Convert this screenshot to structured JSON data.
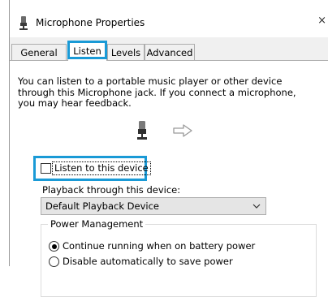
{
  "window": {
    "title": "Microphone Properties",
    "close_glyph": "×",
    "title_icon": "microphone-icon"
  },
  "tabs": [
    {
      "label": "General",
      "active": false
    },
    {
      "label": "Listen",
      "active": true
    },
    {
      "label": "Levels",
      "active": false
    },
    {
      "label": "Advanced",
      "active": false
    }
  ],
  "listen": {
    "description": "You can listen to a portable music player or other device through this Microphone  jack.  If you connect a microphone, you may hear feedback.",
    "listen_checkbox_label": "Listen to this device",
    "listen_checked": false,
    "playback_label": "Playback through this device:",
    "playback_selected": "Default Playback Device",
    "power_group_label": "Power Management",
    "power_options": [
      {
        "label": "Continue running when on battery power",
        "selected": true
      },
      {
        "label": "Disable automatically to save power",
        "selected": false
      }
    ]
  },
  "colors": {
    "highlight": "#1a9ad6",
    "dialog_bg": "#f0f0f0",
    "dropdown_bg": "#e5e5e5"
  }
}
